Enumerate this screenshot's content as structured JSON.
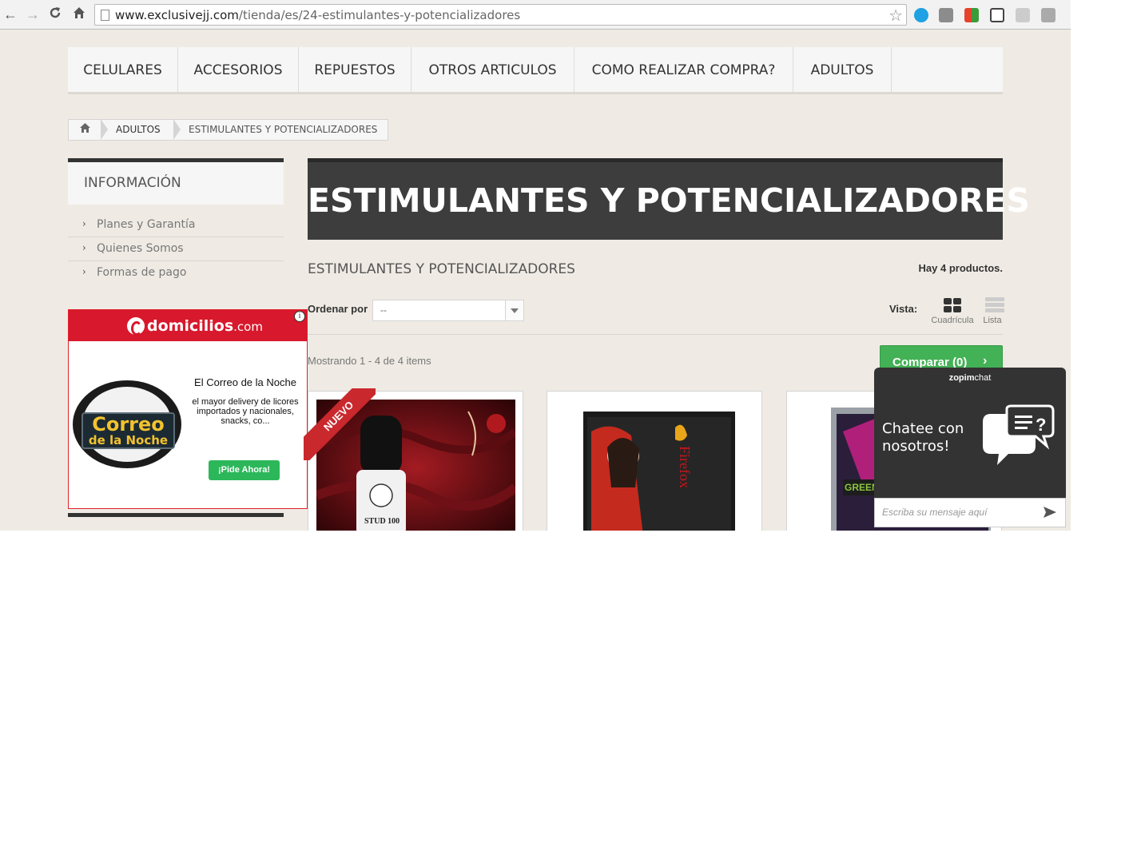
{
  "browser": {
    "url_host": "www.exclusivejj.com",
    "url_path": "/tienda/es/24-estimulantes-y-potencializadores",
    "nav": {
      "back": "←",
      "forward": "→",
      "reload": "C",
      "home": "⌂"
    },
    "star": "☆"
  },
  "menu": {
    "items": [
      "CELULARES",
      "ACCESORIOS",
      "REPUESTOS",
      "OTROS ARTICULOS",
      "COMO REALIZAR COMPRA?",
      "ADULTOS"
    ]
  },
  "breadcrumb": {
    "home_icon": "home-icon",
    "items": [
      "ADULTOS",
      "ESTIMULANTES Y POTENCIALIZADORES"
    ]
  },
  "sidebar": {
    "info_title": "INFORMACIÓN",
    "links": [
      "Planes y Garantía",
      "Quienes Somos",
      "Formas de pago"
    ],
    "chevron": "›"
  },
  "ad": {
    "brand": "domicilios",
    "brand_suffix": ".com",
    "info": "i",
    "sign_line1": "Correo",
    "sign_line2": "de la Noche",
    "title": "El Correo de la Noche",
    "description": "el mayor delivery de licores importados y nacionales, snacks, co...",
    "cta": "¡Pide Ahora!"
  },
  "category": {
    "banner_title": "ESTIMULANTES Y POTENCIALIZADORES",
    "name": "ESTIMULANTES Y POTENCIALIZADORES",
    "product_count": "Hay 4 productos."
  },
  "controls": {
    "sort_label": "Ordenar por",
    "sort_value": "--",
    "view_label": "Vista:",
    "view_grid": "Cuadrícula",
    "view_list": "Lista",
    "showing": "Mostrando 1 - 4 de 4 items",
    "compare": "Comparar (0)",
    "compare_chevron": "›"
  },
  "products": [
    {
      "badge": "NUEVO",
      "label": "STUD 100"
    },
    {
      "label": "Firefox"
    },
    {
      "label": "GREEN"
    }
  ],
  "chat": {
    "brand_a": "zopim",
    "brand_b": "chat",
    "greeting": "Chatee con nosotros!",
    "placeholder": "Escriba su mensaje aquí"
  },
  "colors": {
    "page_bg": "#efebe4",
    "banner_bg": "#3d3d3d",
    "compare_green": "#43b155",
    "ad_red": "#d8182c",
    "ribbon_red": "#c9282d"
  }
}
